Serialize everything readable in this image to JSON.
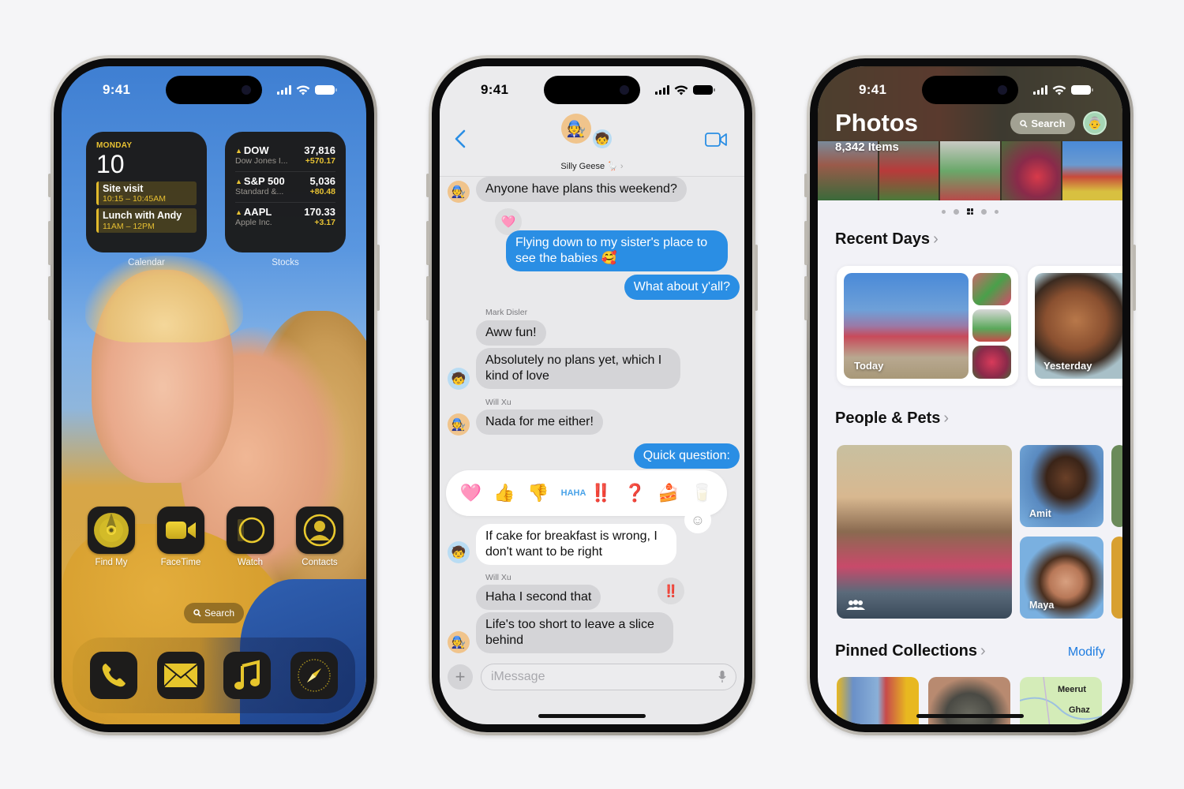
{
  "status_bar": {
    "time": "9:41"
  },
  "home_screen": {
    "calendar_widget": {
      "weekday": "MONDAY",
      "date": "10",
      "events": [
        {
          "title": "Site visit",
          "time": "10:15 – 10:45AM"
        },
        {
          "title": "Lunch with Andy",
          "time": "11AM – 12PM"
        }
      ],
      "label": "Calendar"
    },
    "stocks_widget": {
      "rows": [
        {
          "symbol": "DOW",
          "name": "Dow Jones I...",
          "price": "37,816",
          "change": "+570.17"
        },
        {
          "symbol": "S&P 500",
          "name": "Standard &...",
          "price": "5,036",
          "change": "+80.48"
        },
        {
          "symbol": "AAPL",
          "name": "Apple Inc.",
          "price": "170.33",
          "change": "+3.17"
        }
      ],
      "label": "Stocks"
    },
    "apps": [
      {
        "label": "Find My",
        "icon": "find-my-icon"
      },
      {
        "label": "FaceTime",
        "icon": "facetime-icon"
      },
      {
        "label": "Watch",
        "icon": "watch-icon"
      },
      {
        "label": "Contacts",
        "icon": "contacts-icon"
      }
    ],
    "search_label": "Search",
    "dock": [
      {
        "icon": "phone-icon"
      },
      {
        "icon": "mail-icon"
      },
      {
        "icon": "music-icon"
      },
      {
        "icon": "safari-icon"
      }
    ],
    "tint_color": "#e3c02a"
  },
  "messages": {
    "group_name": "Silly Geese",
    "group_emoji": "🪿",
    "accent_color": "#2a8ee4",
    "thread": [
      {
        "id": "m1",
        "from": "Will Xu",
        "direction": "in",
        "text": "Anyone have plans this weekend?"
      },
      {
        "id": "m2",
        "direction": "out",
        "text": "Flying down to my sister's place to see the babies 🥰",
        "tapback": "❤️"
      },
      {
        "id": "m3",
        "direction": "out",
        "text": "What about y'all?"
      },
      {
        "id": "m4",
        "from": "Mark Disler",
        "direction": "in",
        "text": "Aww fun!"
      },
      {
        "id": "m5",
        "from": "Mark Disler",
        "direction": "in",
        "text": "Absolutely no plans yet, which I kind of love"
      },
      {
        "id": "m6",
        "from": "Will Xu",
        "direction": "in",
        "text": "Nada for me either!"
      },
      {
        "id": "m7",
        "direction": "out",
        "text": "Quick question:"
      },
      {
        "id": "m8",
        "from": "Mark Disler",
        "direction": "in",
        "text": "If cake for breakfast is wrong, I don't want to be right"
      },
      {
        "id": "m9",
        "from": "Will Xu",
        "direction": "in",
        "text": "Haha I second that"
      },
      {
        "id": "m10",
        "from": "Will Xu",
        "direction": "in",
        "text": "Life's too short to leave a slice behind",
        "tapback": "‼️"
      }
    ],
    "sender_labels": {
      "mark": "Mark Disler",
      "will": "Will Xu"
    },
    "tapback_options": [
      "🩷",
      "👍",
      "👎",
      "HAHA",
      "‼️",
      "❓",
      "🍰",
      "🥛"
    ],
    "composer_placeholder": "iMessage"
  },
  "photos": {
    "title": "Photos",
    "item_count": "8,342 Items",
    "search_label": "Search",
    "sections": {
      "recent_days": {
        "title": "Recent Days",
        "cards": [
          "Today",
          "Yesterday"
        ]
      },
      "people_pets": {
        "title": "People & Pets",
        "people": [
          "Amit",
          "Maya"
        ]
      },
      "pinned": {
        "title": "Pinned Collections",
        "action": "Modify",
        "map_labels": [
          "Meerut",
          "Ghaz"
        ]
      }
    },
    "accent_color": "#1e7ce0"
  }
}
